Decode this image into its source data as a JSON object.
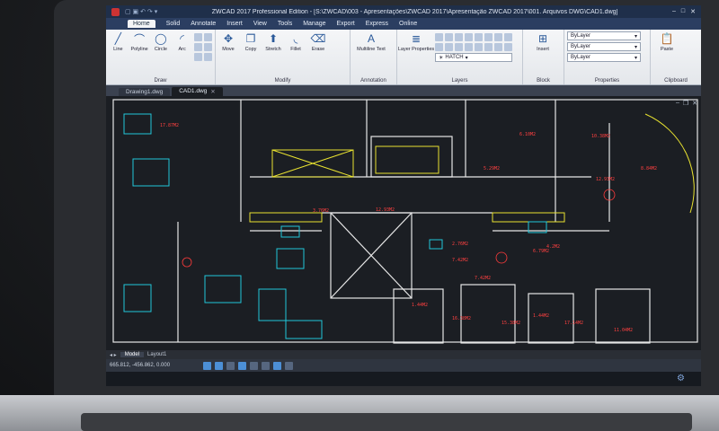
{
  "titlebar": {
    "title": "ZWCAD 2017 Professional Edition - [S:\\ZWCAD\\003 - Apresentações\\ZWCAD 2017\\Apresentação ZWCAD 2017\\001. Arquivos DWG\\CAD1.dwg]"
  },
  "menu": [
    "Home",
    "Solid",
    "Annotate",
    "Insert",
    "View",
    "Tools",
    "Manage",
    "Export",
    "Express",
    "Online"
  ],
  "ribbon": {
    "draw": {
      "label": "Draw",
      "tools": [
        "Line",
        "Polyline",
        "Circle",
        "Arc"
      ]
    },
    "modify": {
      "label": "Modify",
      "tools": [
        "Move",
        "Copy",
        "Stretch",
        "Fillet",
        "Erase"
      ]
    },
    "annotation": {
      "label": "Annotation",
      "tools": [
        "Multiline Text"
      ]
    },
    "layers": {
      "label": "Layers",
      "tools": [
        "Layer Properties"
      ],
      "current_layer": "HATCH"
    },
    "block": {
      "label": "Block",
      "tools": [
        "Insert"
      ]
    },
    "properties": {
      "label": "Properties",
      "color": "ByLayer",
      "linetype": "ByLayer",
      "lineweight": "ByLayer"
    },
    "clipboard": {
      "label": "Clipboard",
      "tools": [
        "Paste"
      ]
    }
  },
  "doc_tabs": [
    "Drawing1.dwg",
    "CAD1.dwg"
  ],
  "layout_tabs": [
    "Model",
    "Layout1"
  ],
  "coordinates": "665.812, -456.862, 0.000",
  "room_labels": [
    "6.10M2",
    "10.38M2",
    "5.29M2",
    "12.93M2",
    "7.42M2",
    "6.79M2",
    "3.76M2",
    "1.44M2",
    "16.38M2",
    "15.38M2",
    "11.04M2",
    "17.14M2",
    "12.93M2",
    "2.76M2",
    "7.42M2",
    "4.2M2",
    "1.44M2",
    "8.84M2",
    "17.87M2"
  ],
  "colors": {
    "walls": "#e6e6e6",
    "room_labels": "#ff3b3b",
    "furniture": "#21c7d9",
    "yellow_elements": "#e8e230",
    "accent": "#2b3e61"
  }
}
